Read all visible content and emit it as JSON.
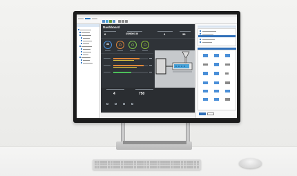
{
  "hmi": {
    "title": "Dashboard",
    "gauges": [
      {
        "value": "34",
        "label": "",
        "color": "#4a8fd8"
      },
      {
        "value": "",
        "label": "",
        "color": "#e0883a"
      },
      {
        "value": "",
        "label": "",
        "color": "#7cbf4a"
      },
      {
        "value": "",
        "label": "",
        "color": "#8fbf3a"
      }
    ],
    "bar_colors": [
      "#e0883a",
      "#d8c040",
      "#7cbf4a",
      "#4cbf5a"
    ],
    "info_value": "4/5/6060 36",
    "counter_value": "4",
    "total_value": "750",
    "accent": "#4a8fd8",
    "machine_color": "#d9d9d9",
    "nozzle_color": "#4aa3d8"
  },
  "colors": {
    "ribbon_accent": "#2b78c2",
    "panel_header": "#2f6fb8",
    "hmi_background": "#2f3338"
  },
  "icons": {
    "hmi_icons": [
      "gear-icon",
      "info-icon",
      "alarm-icon",
      "trend-icon"
    ]
  }
}
